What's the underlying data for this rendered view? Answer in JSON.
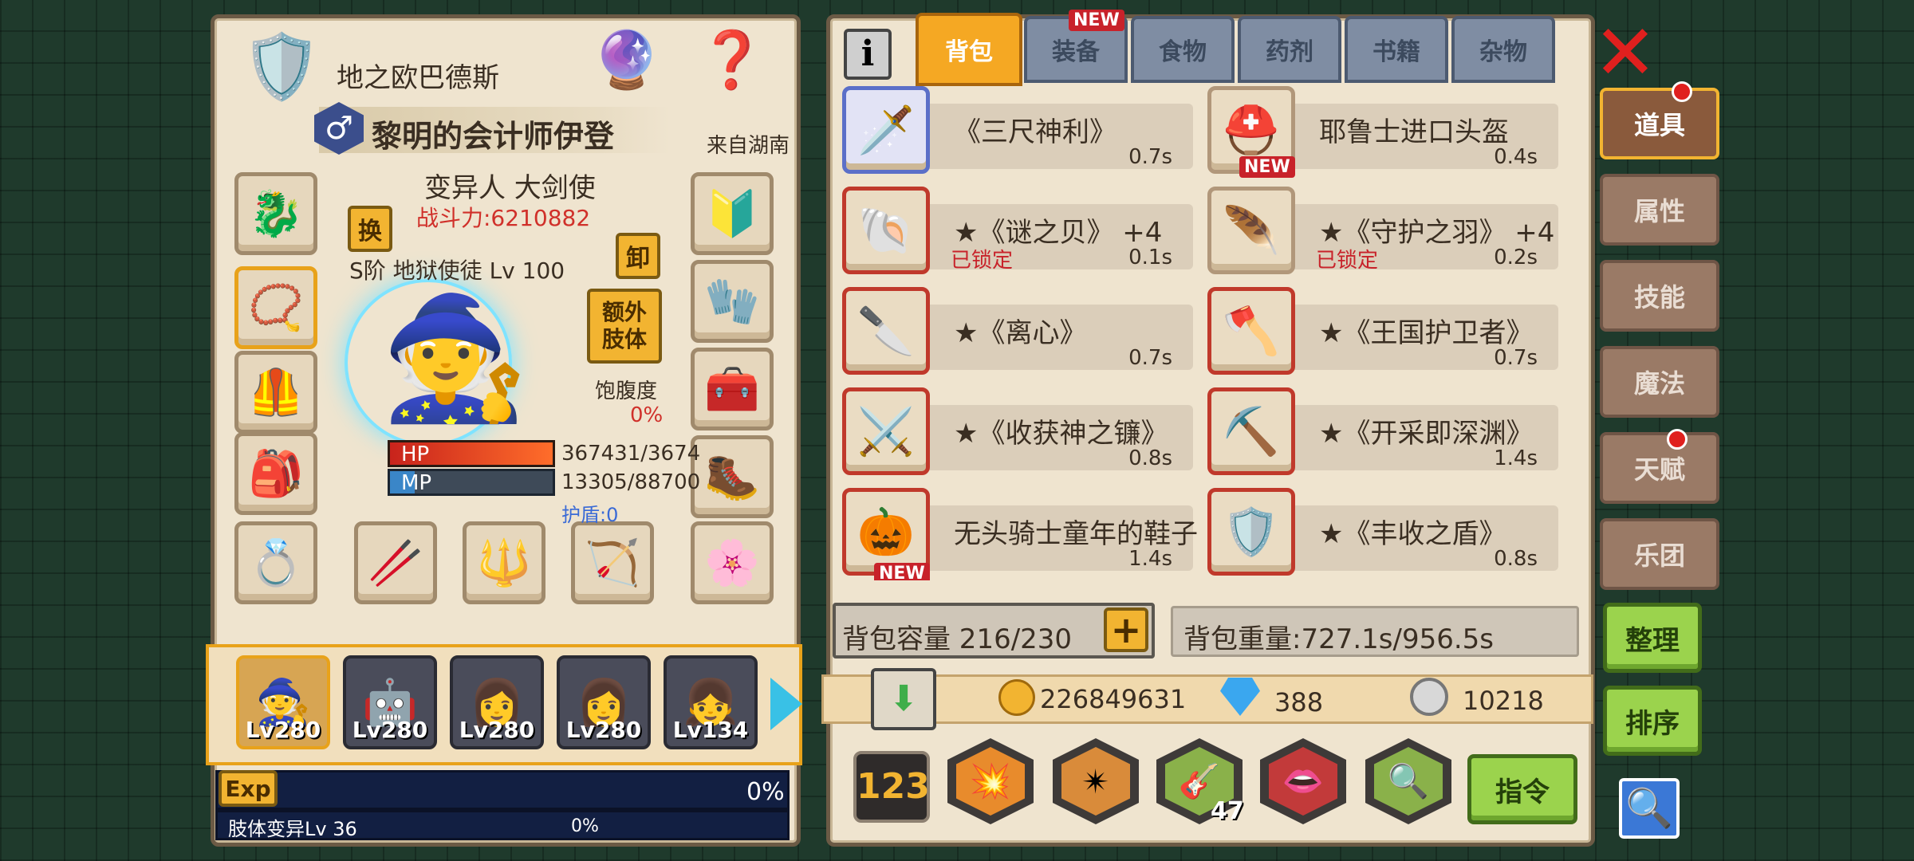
{
  "character": {
    "title": "地之欧巴德斯",
    "name": "黎明的会计师伊登",
    "origin": "来自湖南",
    "class": "变异人 大剑使",
    "power": "战斗力:6210882",
    "pet": "S阶 地狱使徒 Lv 100",
    "swap_label": "换",
    "unequip_label": "卸",
    "extra_limb_label": "额外肢体",
    "satiety_label": "饱腹度",
    "satiety_value": "0%",
    "hp_label": "HP",
    "hp_value": "367431/3674",
    "mp_label": "MP",
    "mp_value": "13305/88700",
    "shield": "护盾:0",
    "hp_fraction": 1.0,
    "mp_fraction": 0.15,
    "exp_label": "Exp",
    "exp_value": "0%",
    "limb_mutation": "肢体变异Lv 36",
    "limb_exp": "0%"
  },
  "party": [
    {
      "level": "Lv280",
      "icon": "wizard-portrait"
    },
    {
      "level": "Lv280",
      "icon": "knight-portrait"
    },
    {
      "level": "Lv280",
      "icon": "nurse-portrait"
    },
    {
      "level": "Lv280",
      "icon": "nurse-portrait"
    },
    {
      "level": "Lv134",
      "icon": "maid-portrait"
    }
  ],
  "tabs": [
    {
      "label": "背包",
      "active": true
    },
    {
      "label": "装备",
      "new": "NEW"
    },
    {
      "label": "食物"
    },
    {
      "label": "药剂"
    },
    {
      "label": "书籍"
    },
    {
      "label": "杂物"
    }
  ],
  "items": [
    {
      "name": "《三尺神利》",
      "time": "0.7s",
      "icon": "sword-icon"
    },
    {
      "name": "耶鲁士进口头盔",
      "time": "0.4s",
      "icon": "helmet-icon",
      "new": "NEW"
    },
    {
      "name": "★《谜之贝》 +4",
      "time": "0.1s",
      "lock": "已锁定",
      "icon": "shell-icon"
    },
    {
      "name": "★《守护之羽》 +4",
      "time": "0.2s",
      "lock": "已锁定",
      "icon": "feather-icon"
    },
    {
      "name": "★《离心》",
      "time": "0.7s",
      "icon": "dagger-icon"
    },
    {
      "name": "★《王国护卫者》",
      "time": "0.7s",
      "icon": "axe-icon"
    },
    {
      "name": "★《收获神之镰》",
      "time": "0.8s",
      "icon": "scythe-icon"
    },
    {
      "name": "★《开采即深渊》",
      "time": "1.4s",
      "icon": "pickaxe-icon"
    },
    {
      "name": "无头骑士童年的鞋子",
      "time": "1.4s",
      "icon": "pumpkin-icon",
      "new": "NEW"
    },
    {
      "name": "★《丰收之盾》",
      "time": "0.8s",
      "icon": "shield-icon"
    }
  ],
  "side_tabs": [
    "道具",
    "属性",
    "技能",
    "魔法",
    "天赋",
    "乐团"
  ],
  "capacity": "背包容量 216/230",
  "weight": "背包重量:727.1s/956.5s",
  "gold": "226849631",
  "gems": "388",
  "silver": "10218",
  "sort_label": "整理",
  "order_label": "排序",
  "command_label": "指令",
  "skill_count": "47",
  "new_label": "NEW",
  "colors": {
    "accent": "#f5a823",
    "hp": "#e23a2e",
    "mp": "#3a86c8",
    "panel": "#efe4cf"
  }
}
